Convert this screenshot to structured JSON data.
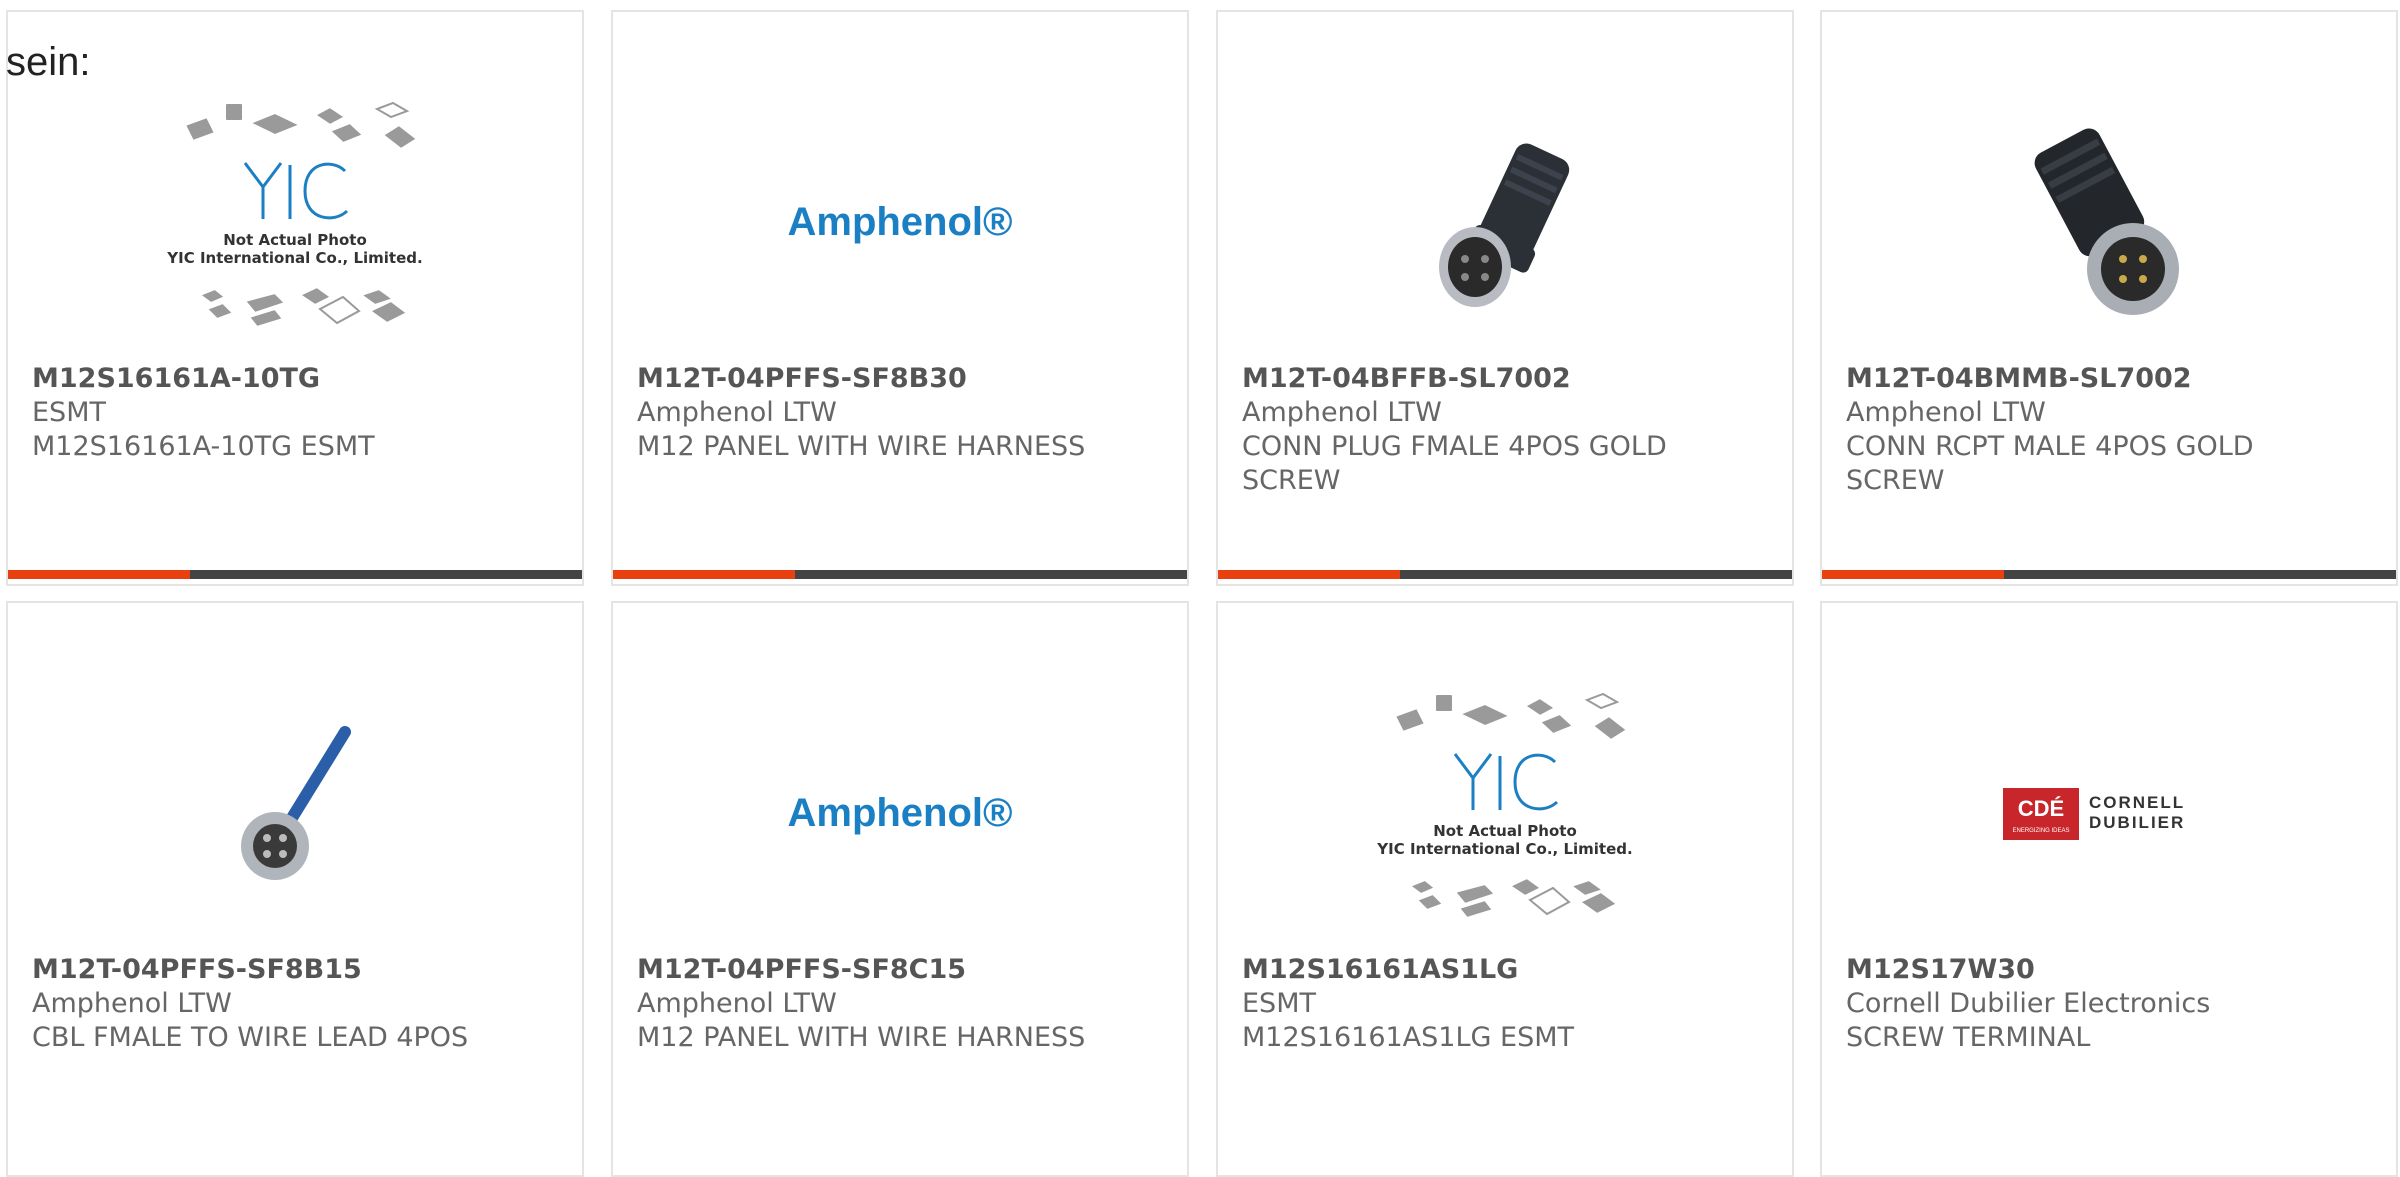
{
  "page": {
    "intro_text": "sein:"
  },
  "colors": {
    "accent": "#e8410f",
    "bar": "#444444",
    "text": "#666666",
    "border": "#e4e4e4",
    "amphenol_blue": "#1b7fc4",
    "cde_red": "#c8262b"
  },
  "logos": {
    "yic_line1": "Not Actual Photo",
    "yic_line2": "YIC International Co., Limited.",
    "amphenol": "Amphenol®",
    "cde_mark": "CDÉ",
    "cde_name_1": "CORNELL",
    "cde_name_2": "DUBILIER",
    "cde_tagline": "ENERGIZING IDEAS"
  },
  "products": [
    {
      "pn": "M12S16161A-10TG",
      "mfr": "ESMT",
      "desc": "M12S16161A-10TG ESMT",
      "image": "yic-placeholder"
    },
    {
      "pn": "M12T-04PFFS-SF8B30",
      "mfr": "Amphenol LTW",
      "desc": "M12 PANEL WITH WIRE HARNESS",
      "image": "amphenol-logo"
    },
    {
      "pn": "M12T-04BFFB-SL7002",
      "mfr": "Amphenol LTW",
      "desc": "CONN PLUG FMALE 4POS GOLD SCREW",
      "image": "female-connector-photo"
    },
    {
      "pn": "M12T-04BMMB-SL7002",
      "mfr": "Amphenol LTW",
      "desc": "CONN RCPT MALE 4POS GOLD SCREW",
      "image": "male-connector-photo"
    },
    {
      "pn": "M12T-04PFFS-SF8B15",
      "mfr": "Amphenol LTW",
      "desc": "CBL FMALE TO WIRE LEAD 4POS",
      "image": "panel-connector-photo"
    },
    {
      "pn": "M12T-04PFFS-SF8C15",
      "mfr": "Amphenol LTW",
      "desc": "M12 PANEL WITH WIRE HARNESS",
      "image": "amphenol-logo"
    },
    {
      "pn": "M12S16161AS1LG",
      "mfr": "ESMT",
      "desc": "M12S16161AS1LG ESMT",
      "image": "yic-placeholder"
    },
    {
      "pn": "M12S17W30",
      "mfr": "Cornell Dubilier Electronics",
      "desc": "SCREW TERMINAL",
      "image": "cde-logo"
    }
  ]
}
